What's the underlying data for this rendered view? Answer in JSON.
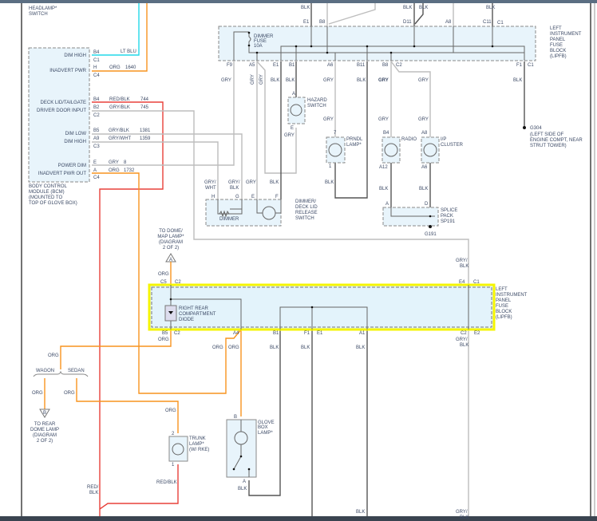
{
  "colors": {
    "wire_gray": "#bdbdbd",
    "wire_black": "#555555",
    "wire_orange": "#f7931e",
    "wire_red": "#e8403a",
    "wire_lt_blue": "#22d8e8",
    "highlight": "#f5f500",
    "module_fill": "#e8f4fb"
  },
  "headlamp": {
    "l1": "HEADLAMP*",
    "l2": "SWITCH"
  },
  "bcm": {
    "pins": [
      "DIM HIGH",
      "INADVERT PWR",
      "DECK LID/TAILGATE",
      "DRIVER DOOR INPUT",
      "DIM LOW",
      "DIM HIGH",
      "POWER DIM",
      "INADVERT PWR OUT"
    ],
    "terminals": [
      "B4",
      "C1",
      "H",
      "C4",
      "B4",
      "B2",
      "C2",
      "B5",
      "A9",
      "C3",
      "E",
      "A",
      "C4"
    ],
    "wires": [
      {
        "color": "LT BLU",
        "circuit": ""
      },
      {
        "color": "ORG",
        "circuit": "1640"
      },
      {
        "color": "RED/BLK",
        "circuit": "744"
      },
      {
        "color": "GRY/BLK",
        "circuit": "745"
      },
      {
        "color": "GRY/BLK",
        "circuit": "1381"
      },
      {
        "color": "GRY/WHT",
        "circuit": "1359"
      },
      {
        "color": "GRY",
        "circuit": "8"
      },
      {
        "color": "ORG",
        "circuit": "1732"
      }
    ],
    "caption": [
      "BODY CONTROL",
      "MODULE (BCM)",
      "(MOUNTED TO",
      "TOP OF GLOVE BOX)"
    ]
  },
  "fuse_top": {
    "top_wires": [
      "BLK",
      "BLK",
      "BLK",
      "BLK"
    ],
    "top_pins": [
      "E1",
      "B8",
      "D11",
      "A8",
      "C11",
      "C1"
    ],
    "bottom_pins": [
      "F9",
      "A5",
      "E1",
      "B1",
      "A6",
      "B11",
      "B8",
      "C2",
      "F1",
      "C1"
    ],
    "fuse": [
      "DIMMER",
      "FUSE",
      "10A"
    ],
    "name": [
      "LEFT",
      "INSTRUMENT",
      "PANEL",
      "FUSE",
      "BLOCK",
      "(LIPFB)"
    ],
    "wires_below": [
      "GRY",
      "GRY",
      "GRY",
      "BLK",
      "BLK",
      "GRY",
      "BLK",
      "GRY",
      "GRY",
      "BLK"
    ]
  },
  "hazard": {
    "pin_a": "A",
    "pin_e": "E",
    "name": [
      "HAZARD",
      "SWITCH"
    ],
    "wire": "GRY"
  },
  "prndl": {
    "pin_top": "7",
    "pin_bot": "1",
    "name": [
      "PRNDL",
      "LAMP*"
    ],
    "wire_top": "GRY",
    "wire_bot": "BLK"
  },
  "radio": {
    "pin_top": "B4",
    "pin_bot": "A12",
    "name": "RADIO",
    "wire_top": "GRY",
    "wire_bot": "BLK"
  },
  "cluster": {
    "pin_top": "A8",
    "pin_bot": "A6",
    "name": [
      "I/P",
      "CLUSTER"
    ],
    "wire_top": "GRY",
    "wire_bot": "BLK"
  },
  "splice": {
    "pin_a": "A",
    "pin_d": "D",
    "name": [
      "SPLICE",
      "PACK",
      "SP191"
    ],
    "ground": "G191"
  },
  "g304": {
    "name": "G304",
    "desc": [
      "(LEFT SIDE OF",
      "ENGINE COMPT, NEAR",
      "STRUT TOWER)"
    ]
  },
  "dimmer_switch": {
    "wires": [
      "GRY/",
      "WHT",
      "GRY/",
      "BLK",
      "GRY",
      "BLK"
    ],
    "pins": [
      "H",
      "G",
      "E",
      "F"
    ],
    "inner": "DIMMER",
    "name": [
      "DIMMER/",
      "DECK LID",
      "RELEASE",
      "SWITCH"
    ]
  },
  "dome": {
    "text": [
      "TO DOME/",
      "MAP LAMP*",
      "(DIAGRAM",
      "2 OF 2)"
    ],
    "connector": "A",
    "wire": "ORG"
  },
  "fuse_bottom": {
    "top_pins": [
      "C5",
      "C2",
      "E4",
      "C1"
    ],
    "top_wire": [
      "GRY/",
      "BLK"
    ],
    "bottom_pins": [
      "B5",
      "C2",
      "A4",
      "B1",
      "F1",
      "E1",
      "A1",
      "C2",
      "E2"
    ],
    "diode": [
      "RIGHT REAR",
      "COMPARTMENT",
      "DIODE"
    ],
    "name": [
      "LEFT",
      "INSTRUMENT",
      "PANEL",
      "FUSE",
      "BLOCK",
      "(LIPFB)"
    ],
    "wires_below": [
      "ORG",
      "ORG",
      "ORG",
      "BLK",
      "BLK",
      "BLK",
      "GRY/",
      "BLK"
    ]
  },
  "branch": {
    "wagon": "WAGON",
    "sedan": "SEDAN",
    "org1": "ORG",
    "org2": "ORG",
    "org3": "ORG",
    "org4": "ORG"
  },
  "rear_dome": {
    "connector": "B",
    "text": [
      "TO REAR",
      "DOME LAMP",
      "(DIAGRAM",
      "2 OF 2)"
    ]
  },
  "trunk": {
    "pin_top": "2",
    "pin_bot": "1",
    "name": [
      "TRUNK",
      "LAMP*",
      "(W/ RKE)"
    ],
    "wire": "RED/BLK"
  },
  "red_label": [
    "RED/",
    "BLK"
  ],
  "glove": {
    "pin_top": "B",
    "pin_bot": "A",
    "name": [
      "GLOVE",
      "BOX",
      "LAMP*"
    ],
    "wire": "BLK"
  },
  "bottom_labels": [
    "BLK",
    "GRY/",
    "BLK"
  ]
}
